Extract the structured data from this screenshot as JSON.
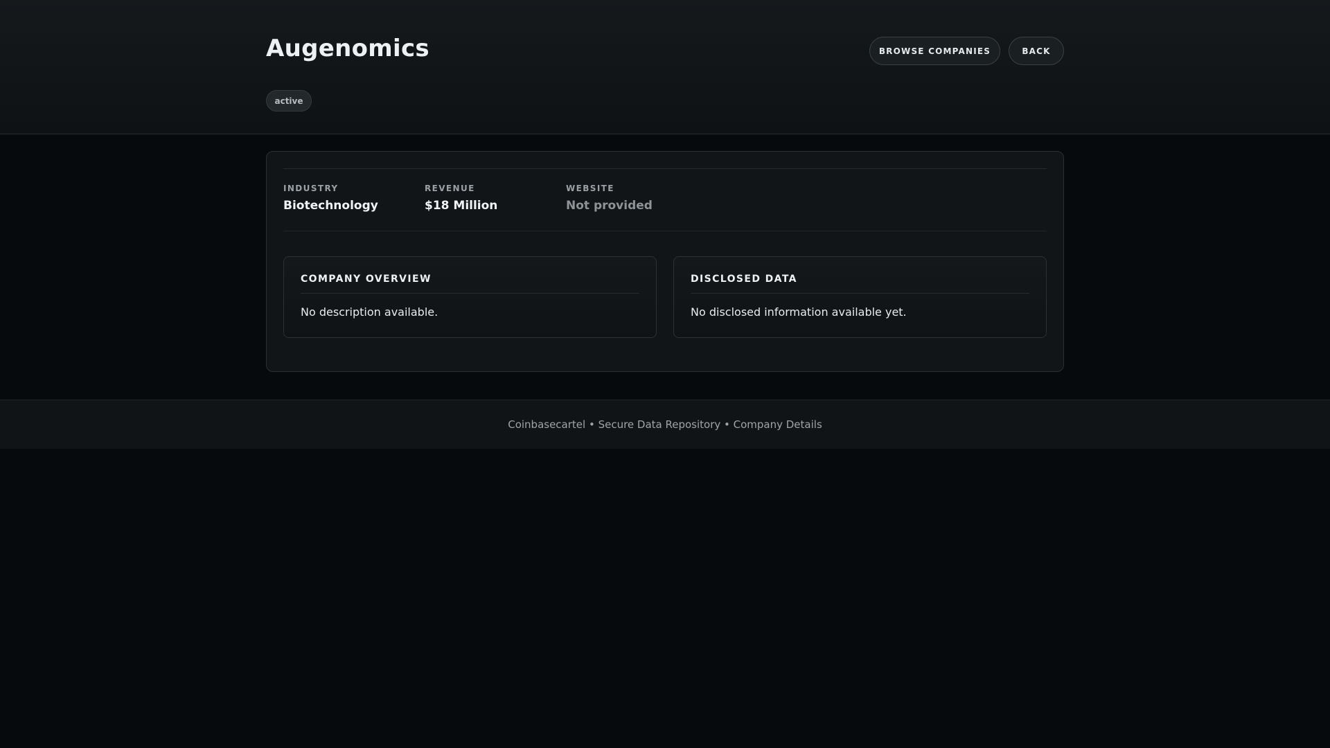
{
  "header": {
    "title": "Augenomics",
    "status_badge": "active",
    "browse_button": "BROWSE COMPANIES",
    "back_button": "BACK"
  },
  "details": {
    "industry_label": "INDUSTRY",
    "industry_value": "Biotechnology",
    "revenue_label": "REVENUE",
    "revenue_value": "$18 Million",
    "website_label": "WEBSITE",
    "website_value": "Not provided"
  },
  "overview": {
    "title": "COMPANY OVERVIEW",
    "text": "No description available."
  },
  "disclosed": {
    "title": "DISCLOSED DATA",
    "text": "No disclosed information available yet."
  },
  "footer": {
    "text": "Coinbasecartel • Secure Data Repository • Company Details"
  }
}
